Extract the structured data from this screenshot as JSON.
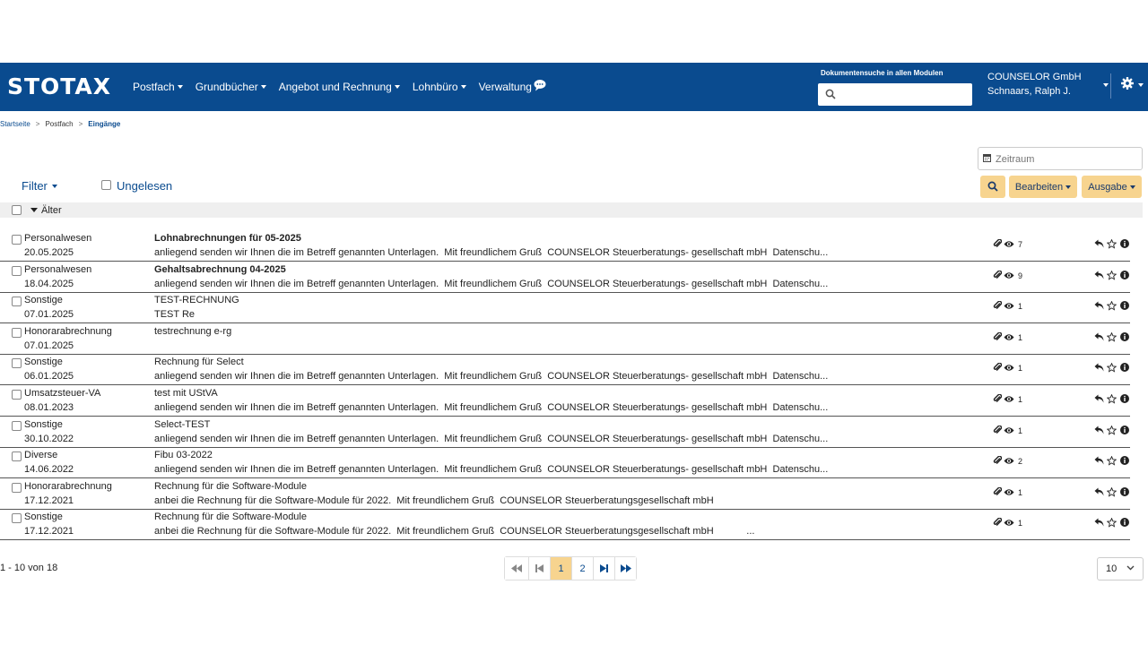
{
  "brand": {
    "logo_text": "STOTAX",
    "color": "#0a4b8f",
    "accent": "#f7d48f"
  },
  "nav": {
    "items": [
      {
        "label": "Postfach"
      },
      {
        "label": "Grundbücher"
      },
      {
        "label": "Angebot und Rechnung"
      },
      {
        "label": "Lohnbüro"
      },
      {
        "label": "Verwaltung"
      }
    ],
    "chat_icon": "comment-icon"
  },
  "doc_search": {
    "label": "Dokumentensuche in allen Modulen",
    "value": ""
  },
  "user": {
    "company": "COUNSELOR GmbH",
    "name": "Schnaars, Ralph J."
  },
  "breadcrumb": {
    "home": "Startseite",
    "section": "Postfach",
    "current": "Eingänge",
    "separator": ">"
  },
  "toolbar": {
    "zeitraum_placeholder": "Zeitraum",
    "filter_label": "Filter",
    "unread_label": "Ungelesen",
    "edit_label": "Bearbeiten",
    "output_label": "Ausgabe"
  },
  "group": {
    "label": "Älter"
  },
  "messages": [
    {
      "category": "Personalwesen",
      "date": "20.05.2025",
      "subject": "Lohnabrechnungen für 05-2025",
      "unread": true,
      "preview": "anliegend senden wir Ihnen die im Betreff genannten Unterlagen.  Mit freundlichem Gruß  COUNSELOR Steuerberatungs- gesellschaft mbH  Datenschu...",
      "count": "7"
    },
    {
      "category": "Personalwesen",
      "date": "18.04.2025",
      "subject": "Gehaltsabrechnung 04-2025",
      "unread": true,
      "preview": "anliegend senden wir Ihnen die im Betreff genannten Unterlagen.  Mit freundlichem Gruß  COUNSELOR Steuerberatungs- gesellschaft mbH  Datenschu...",
      "count": "9"
    },
    {
      "category": "Sonstige",
      "date": "07.01.2025",
      "subject": "TEST-RECHNUNG",
      "unread": false,
      "preview": "TEST Re",
      "count": "1"
    },
    {
      "category": "Honorarabrechnung",
      "date": "07.01.2025",
      "subject": "testrechnung e-rg",
      "unread": false,
      "preview": "",
      "count": "1"
    },
    {
      "category": "Sonstige",
      "date": "06.01.2025",
      "subject": "Rechnung für Select",
      "unread": false,
      "preview": "anliegend senden wir Ihnen die im Betreff genannten Unterlagen.  Mit freundlichem Gruß  COUNSELOR Steuerberatungs- gesellschaft mbH  Datenschu...",
      "count": "1"
    },
    {
      "category": "Umsatzsteuer-VA",
      "date": "08.01.2023",
      "subject": "test mit UStVA",
      "unread": false,
      "preview": "anliegend senden wir Ihnen die im Betreff genannten Unterlagen.  Mit freundlichem Gruß  COUNSELOR Steuerberatungs- gesellschaft mbH  Datenschu...",
      "count": "1"
    },
    {
      "category": "Sonstige",
      "date": "30.10.2022",
      "subject": "Select-TEST",
      "unread": false,
      "preview": "anliegend senden wir Ihnen die im Betreff genannten Unterlagen.  Mit freundlichem Gruß  COUNSELOR Steuerberatungs- gesellschaft mbH  Datenschu...",
      "count": "1"
    },
    {
      "category": "Diverse",
      "date": "14.06.2022",
      "subject": "Fibu 03-2022",
      "unread": false,
      "preview": "anliegend senden wir Ihnen die im Betreff genannten Unterlagen.  Mit freundlichem Gruß  COUNSELOR Steuerberatungs- gesellschaft mbH  Datenschu...",
      "count": "2"
    },
    {
      "category": "Honorarabrechnung",
      "date": "17.12.2021",
      "subject": "Rechnung für die Software-Module",
      "unread": false,
      "preview": "anbei die Rechnung für die Software-Module für 2022.  Mit freundlichem Gruß  COUNSELOR Steuerberatungsgesellschaft mbH",
      "count": "1"
    },
    {
      "category": "Sonstige",
      "date": "17.12.2021",
      "subject": "Rechnung für die Software-Module",
      "unread": false,
      "preview": "anbei die Rechnung für die Software-Module für 2022.  Mit freundlichem Gruß  COUNSELOR Steuerberatungsgesellschaft mbH            ...",
      "count": "1"
    }
  ],
  "pagination": {
    "info": "1 - 10 von 18",
    "pages": [
      "1",
      "2"
    ],
    "current": "1",
    "per_page": "10"
  }
}
